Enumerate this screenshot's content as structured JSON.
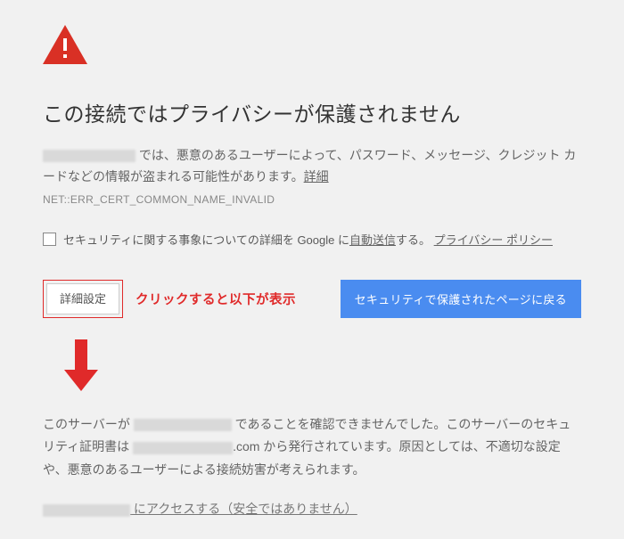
{
  "icon": {
    "color": "#d93025"
  },
  "title": "この接続ではプライバシーが保護されません",
  "body": {
    "masked_prefix_width": 104,
    "text1": " では、悪意のあるユーザーによって、パスワード、メッセージ、クレジット カードなどの情報が盗まれる可能性があります。",
    "learn_more": "詳細"
  },
  "error_code": "NET::ERR_CERT_COMMON_NAME_INVALID",
  "optin": {
    "pre": "セキュリティに関する事象についての詳細を Google に",
    "auto_send": "自動送信",
    "post": "する。",
    "privacy": "プライバシー ポリシー"
  },
  "buttons": {
    "advanced": "詳細設定",
    "primary": "セキュリティで保護されたページに戻る"
  },
  "annotation": "クリックすると以下が表示",
  "arrow_color": "#e02a2a",
  "details": {
    "t1": "このサーバーが ",
    "mask1_w": 110,
    "t2": " であることを確認できませんでした。このサーバーのセキュリティ証明書は ",
    "mask2_w": 112,
    "t3": ".com から発行されています。原因としては、不適切な設定や、悪意のあるユーザーによる接続妨害が考えられます。"
  },
  "proceed": {
    "mask_w": 98,
    "text": " にアクセスする（安全ではありません）"
  }
}
